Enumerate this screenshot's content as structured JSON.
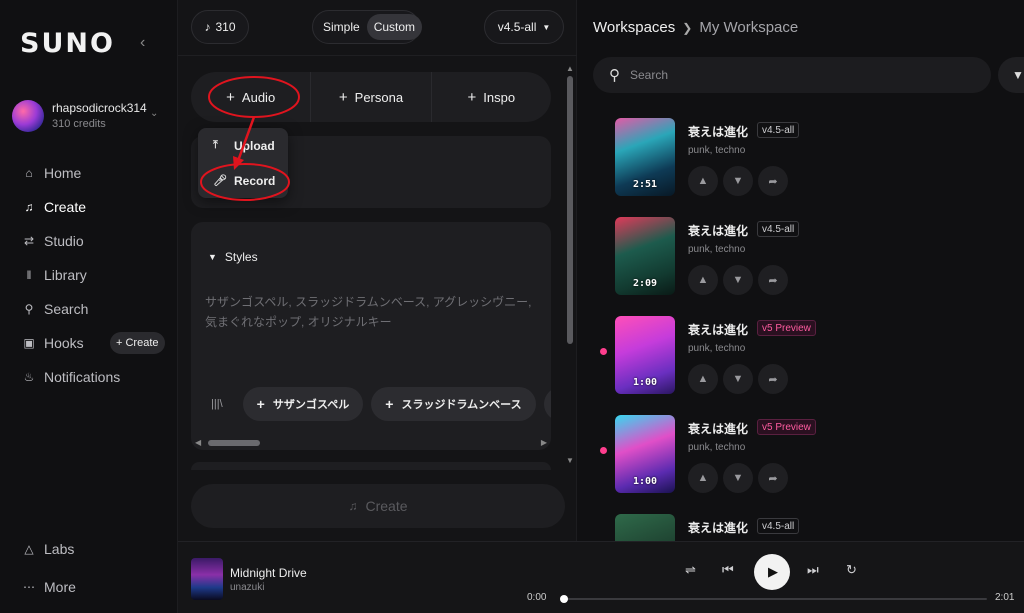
{
  "sidebar": {
    "logo": "SUNO",
    "collapse_icon": "chevron-left-icon",
    "user": {
      "name": "rhapsodicrock314",
      "credits": "310 credits"
    },
    "nav": [
      {
        "label": "Home",
        "icon": "home-icon"
      },
      {
        "label": "Create",
        "icon": "create-icon",
        "active": true
      },
      {
        "label": "Studio",
        "icon": "studio-icon"
      },
      {
        "label": "Library",
        "icon": "library-icon"
      },
      {
        "label": "Search",
        "icon": "search-icon"
      },
      {
        "label": "Hooks",
        "icon": "hooks-icon",
        "badge": "+ Create"
      },
      {
        "label": "Notifications",
        "icon": "bell-icon"
      }
    ],
    "bottom": [
      {
        "label": "Labs",
        "icon": "flask-icon"
      },
      {
        "label": "More",
        "icon": "more-icon"
      }
    ]
  },
  "create": {
    "credits": "310",
    "modes": [
      "Simple",
      "Custom"
    ],
    "active_mode": "Custom",
    "version": "v4.5-all",
    "add_buttons": [
      "Audio",
      "Persona",
      "Inspo"
    ],
    "dropdown": [
      "Upload",
      "Record"
    ],
    "styles": {
      "heading": "Styles",
      "placeholder": "サザンゴスペル, スラッジドラムンベース, アグレッシヴニー, 気まぐれなポップ, オリジナルキー"
    },
    "tags": [
      "サザンゴスペル",
      "スラッジドラムンベース",
      "フ"
    ],
    "create_button": "Create"
  },
  "workspace": {
    "breadcrumb": [
      "Workspaces",
      "My Workspace"
    ],
    "search_placeholder": "Search",
    "songs": [
      {
        "title": "衰えは進化",
        "version": "v4.5-all",
        "genre": "punk, techno",
        "duration": "2:51",
        "unread": false,
        "preview": false
      },
      {
        "title": "衰えは進化",
        "version": "v4.5-all",
        "genre": "punk, techno",
        "duration": "2:09",
        "unread": false,
        "preview": false
      },
      {
        "title": "衰えは進化",
        "version": "v5 Preview",
        "genre": "punk, techno",
        "duration": "1:00",
        "unread": true,
        "preview": true
      },
      {
        "title": "衰えは進化",
        "version": "v5 Preview",
        "genre": "punk, techno",
        "duration": "1:00",
        "unread": true,
        "preview": true
      },
      {
        "title": "衰えは進化",
        "version": "v4.5-all",
        "genre": "",
        "duration": "",
        "unread": false,
        "preview": false
      }
    ]
  },
  "player": {
    "title": "Midnight Drive",
    "artist": "unazuki",
    "current": "0:00",
    "total": "2:01",
    "progress": 0
  },
  "colors": {
    "accent_pink": "#ff3e8e",
    "annotation_red": "#e0141e",
    "background": "#101012"
  }
}
